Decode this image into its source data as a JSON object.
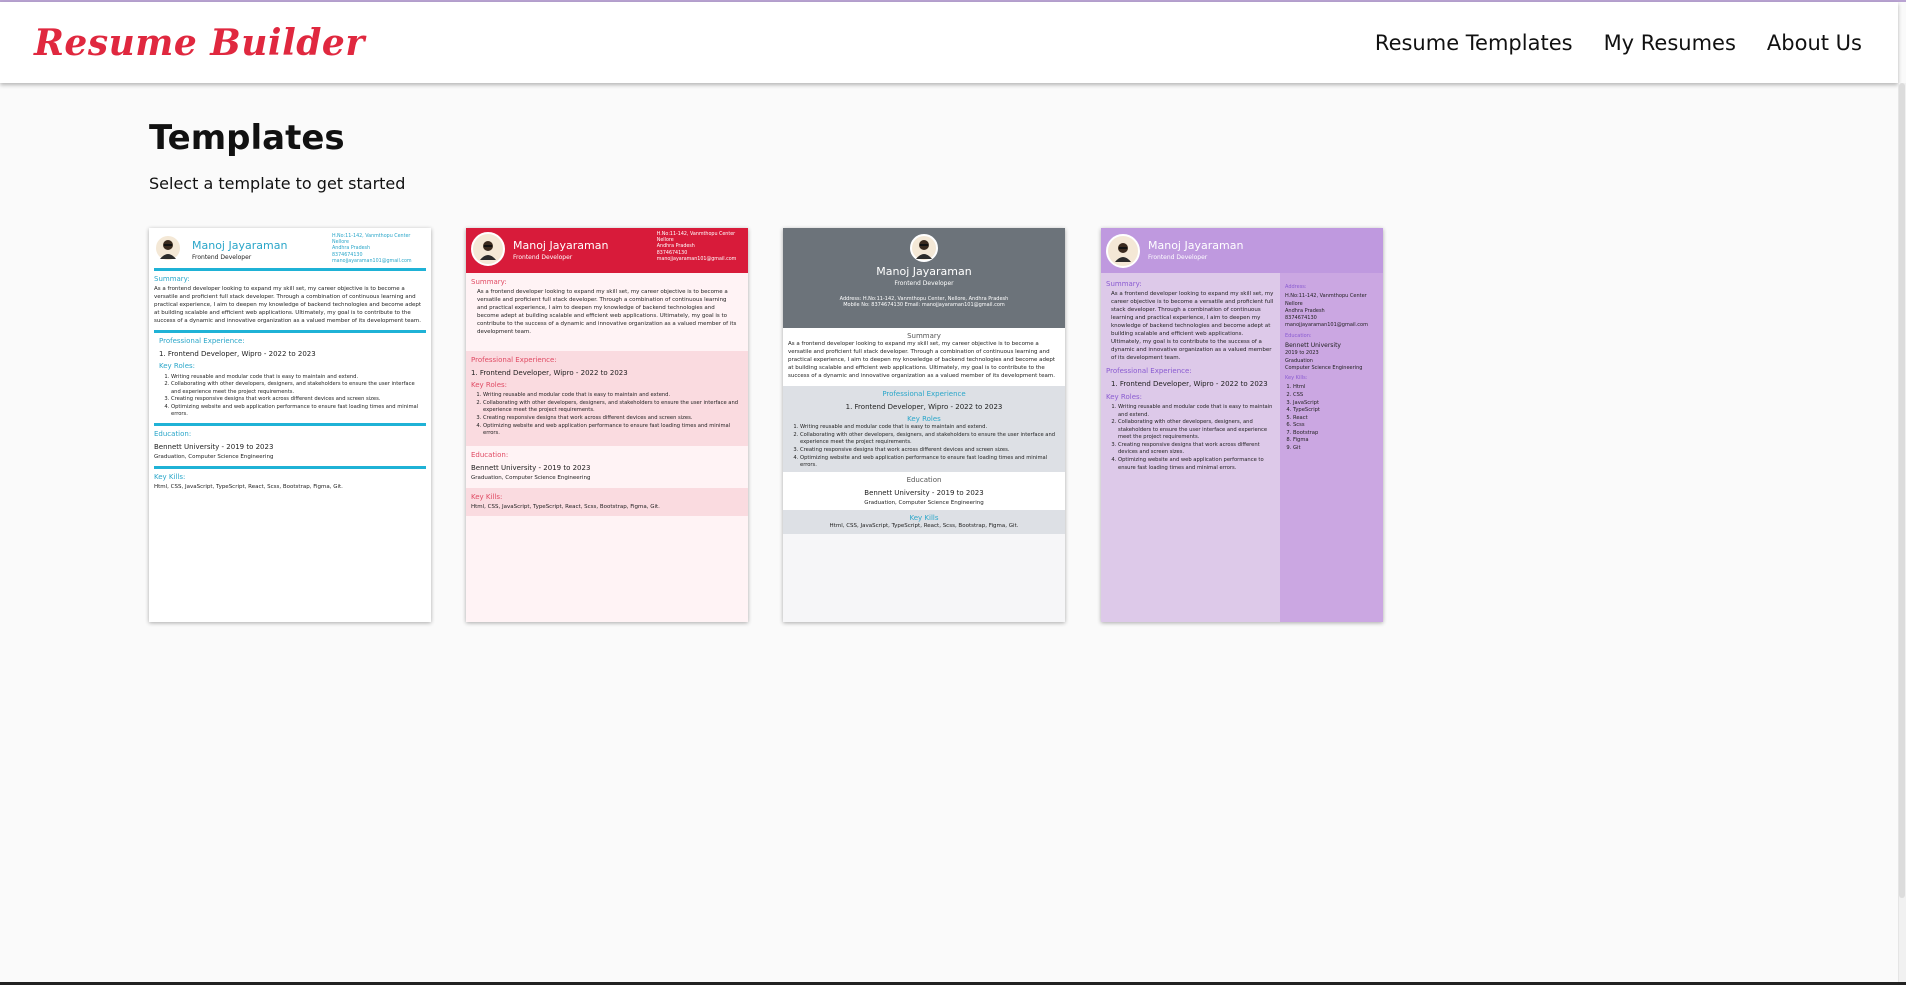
{
  "brand": {
    "name": "Resume Builder",
    "color": "#e0283f"
  },
  "nav": {
    "items": [
      "Resume Templates",
      "My Resumes",
      "About Us"
    ]
  },
  "page": {
    "title": "Templates",
    "subtitle": "Select a template to get started"
  },
  "resume": {
    "name": "Manoj Jayaraman",
    "role": "Frontend Developer",
    "address_lines": [
      "H.No:11-142, Vanmthopu Center",
      "Nellore",
      "Andhra Pradesh"
    ],
    "phone": "8374674130",
    "email": "manojjayaraman101@gmail.com",
    "contact_line": "Address: H.No:11-142, Vanmthopu Center, Nellore, Andhra Pradesh",
    "contact_line2": "Mobile No: 8374674130 Email: manojjayaraman101@gmail.com",
    "summary_label": "Summary:",
    "summary_label_plain": "Summary",
    "summary": "As a frontend developer looking to expand my skill set, my career objective is to become a versatile and proficient full stack developer. Through a combination of continuous learning and practical experience, I aim to deepen my knowledge of backend technologies and become adept at building scalable and efficient web applications. Ultimately, my goal is to contribute to the success of a dynamic and innovative organization as a valued member of its development team.",
    "experience_label": "Professional Experience:",
    "experience_label_plain": "Professional Experience",
    "experience": "Frontend Developer, Wipro - 2022 to 2023",
    "experience_numbered": "1. Frontend Developer, Wipro - 2022 to 2023",
    "key_roles_label": "Key Roles:",
    "key_roles_label_plain": "Key Roles",
    "key_roles": [
      "Writing reusable and modular code that is easy to maintain and extend.",
      "Collaborating with other developers, designers, and stakeholders to ensure the user interface and experience meet the project requirements.",
      "Creating responsive designs that work across different devices and screen sizes.",
      "Optimizing website and web application performance to ensure fast loading times and minimal errors."
    ],
    "education_label": "Education:",
    "education_label_plain": "Education",
    "education": "Bennett University - 2019 to 2023",
    "education_university": "Bennett University",
    "education_years": "2019 to 2023",
    "education_degree": "Graduation",
    "education_field": "Computer Science Engineering",
    "education_detail": "Graduation, Computer Science Engineering",
    "skills_label": "Key Kills:",
    "skills_label_plain": "Key Kills",
    "skills_line": "Html, CSS, JavaScript, TypeScript, React, Scss, Bootstrap, Figma, Git.",
    "skills": [
      "Html",
      "CSS",
      "JavaScript",
      "TypeScript",
      "React",
      "Scss",
      "Bootstrap",
      "Figma",
      "Git"
    ],
    "address_label": "Address:"
  },
  "colors": {
    "template1_accent": "#1fb2d6",
    "template2_header": "#d81b3a",
    "template3_header": "#6c737a",
    "template4_header": "#bf99df"
  },
  "icons": {
    "avatar": "avatar-icon"
  }
}
